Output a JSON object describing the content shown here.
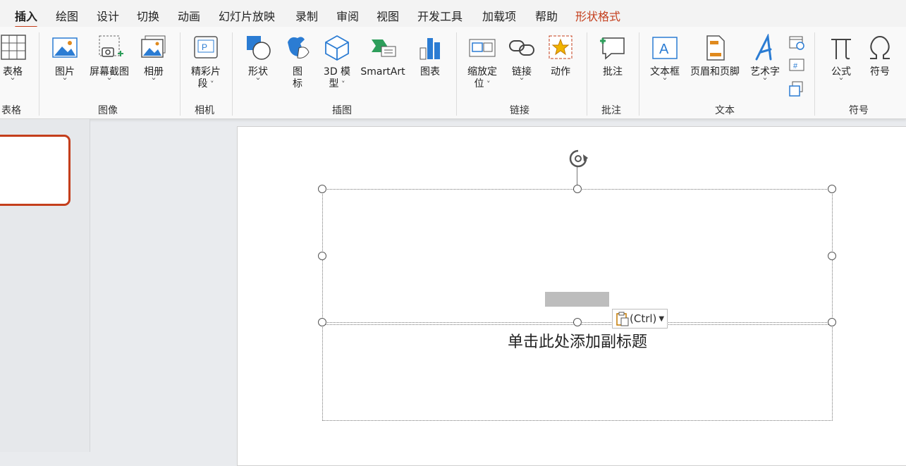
{
  "tabs": [
    {
      "label": "插入",
      "active": true
    },
    {
      "label": "绘图"
    },
    {
      "label": "设计"
    },
    {
      "label": "切换"
    },
    {
      "label": "动画"
    },
    {
      "label": "幻灯片放映"
    },
    {
      "label": "录制"
    },
    {
      "label": "审阅"
    },
    {
      "label": "视图"
    },
    {
      "label": "开发工具"
    },
    {
      "label": "加载项"
    },
    {
      "label": "帮助"
    },
    {
      "label": "形状格式",
      "contextual": true
    }
  ],
  "ribbon": {
    "groups": {
      "table": "表格",
      "images": "图像",
      "camera": "相机",
      "illustrations": "插图",
      "links": "链接",
      "comments": "批注",
      "text": "文本",
      "symbols": "符号"
    },
    "buttons": {
      "table": "表格",
      "picture": "图片",
      "screenshot": "屏幕截图",
      "album": "相册",
      "cameo_line1": "精彩片",
      "cameo_line2": "段",
      "shapes": "形状",
      "icons_line1": "图",
      "icons_line2": "标",
      "model3d_line1": "3D 模",
      "model3d_line2": "型",
      "smartart": "SmartArt",
      "chart": "图表",
      "zoom_line1": "缩放定",
      "zoom_line2": "位",
      "link": "链接",
      "action": "动作",
      "comment": "批注",
      "textbox": "文本框",
      "header_footer": "页眉和页脚",
      "wordart": "艺术字",
      "equation": "公式",
      "symbol": "符号"
    }
  },
  "slide": {
    "subtitle_placeholder": "单击此处添加副标题",
    "paste_options": "(Ctrl)"
  },
  "colors": {
    "accent": "#c43e1c",
    "icon_blue": "#2b7cd3",
    "icon_green": "#2e9e5b",
    "icon_orange": "#e08a1e"
  }
}
